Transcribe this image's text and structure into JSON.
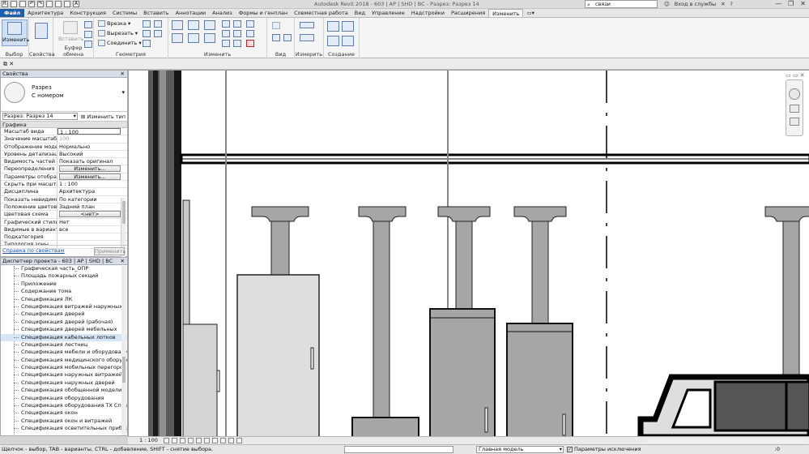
{
  "titlebar": {
    "qat_icons": [
      "revit-logo-icon",
      "open-icon",
      "save-icon",
      "undo-icon",
      "redo-icon",
      "print-icon",
      "measure-icon",
      "dimension-icon",
      "text-icon"
    ],
    "app_title": "Autodesk Revit 2018 -      603 | АР | SHD | ВС - Разрез: Разрез 14",
    "search_value": "связи",
    "signin": "Вход в службы",
    "window_buttons": [
      "—",
      "❐",
      "✕"
    ]
  },
  "tabs": [
    "Файл",
    "Архитектура",
    "Конструкция",
    "Системы",
    "Вставить",
    "Аннотации",
    "Анализ",
    "Формы и генплан",
    "Совместная работа",
    "Вид",
    "Управление",
    "Надстройки",
    "Расширения",
    "Изменить"
  ],
  "active_tab": "Изменить",
  "ribbon": {
    "panels": {
      "select": "Выбор",
      "properties": "Свойства",
      "clipboard": "Буфер обмена",
      "geometry": "Геометрия",
      "modify": "Изменить",
      "view": "Вид",
      "measure": "Измерить",
      "create": "Создание"
    },
    "modify_button": "Изменить",
    "paste_button": "Вставить",
    "geometry_items": [
      "Врезка",
      "Вырезать",
      "Соединить"
    ]
  },
  "properties_panel": {
    "title": "Свойства",
    "type_line1": "Разрез",
    "type_line2": "С номером",
    "filter_value": "Разрез: Разрез 14",
    "edit_type": "Изменить тип",
    "category": "Графика",
    "rows": [
      {
        "name": "Масштаб вида",
        "value": "1 : 100",
        "kind": "edit"
      },
      {
        "name": "Значение масштаба",
        "value": "100",
        "kind": "grey"
      },
      {
        "name": "Отображение модели",
        "value": "Нормально",
        "kind": "text"
      },
      {
        "name": "Уровень детализации",
        "value": "Высокий",
        "kind": "text"
      },
      {
        "name": "Видимость частей",
        "value": "Показать оригинал",
        "kind": "text"
      },
      {
        "name": "Переопределения ви...",
        "value": "Изменить...",
        "kind": "button"
      },
      {
        "name": "Параметры отображ...",
        "value": "Изменить...",
        "kind": "button"
      },
      {
        "name": "Скрыть при масштаб...",
        "value": "1 : 100",
        "kind": "text"
      },
      {
        "name": "Дисциплина",
        "value": "Архитектура",
        "kind": "text"
      },
      {
        "name": "Показать невидимые...",
        "value": "По категории",
        "kind": "text"
      },
      {
        "name": "Положение цветово...",
        "value": "Задний план",
        "kind": "text"
      },
      {
        "name": "Цветовая схема",
        "value": "<нет>",
        "kind": "button"
      },
      {
        "name": "Графический стиль ...",
        "value": "Нет",
        "kind": "text"
      },
      {
        "name": "Видимые в варианте",
        "value": "все",
        "kind": "text"
      },
      {
        "name": "Подкатегория",
        "value": "",
        "kind": "text"
      },
      {
        "name": "Типология зоны...",
        "value": "",
        "kind": "text"
      }
    ],
    "help_link": "Справка по свойствам",
    "apply": "Применить"
  },
  "project_browser": {
    "title": "Диспетчер проекта - 603 | АР | SHD | ВС",
    "items": [
      "Графическая часть_ОПР",
      "Площадь пожарных секций",
      "Приложение",
      "Содержание тома",
      "Спецификация ЛК",
      "Спецификация витражей наружных",
      "Спецификация дверей",
      "Спецификация дверей (рабочая)",
      "Спецификация дверей мебельных",
      "Спецификация кабельных лотков",
      "Спецификация лестниц",
      "Спецификация мебели и оборудования",
      "Спецификация медицинского оборудования",
      "Спецификация мобильных перегородок",
      "Спецификация наружных витражей",
      "Спецификация наружных дверей",
      "Спецификация обобщенной модели",
      "Спецификация оборудования",
      "Спецификация оборудования ТХ Спорт",
      "Спецификация окон",
      "Спецификация окон и витражей",
      "Спецификация осветительных приборов"
    ],
    "selected_index": 9
  },
  "view_control": {
    "scale": "1 : 100"
  },
  "statusbar": {
    "message": "Щелчок - выбор, TAB - варианты, CTRL - добавление, SHIFT - снятие выбора.",
    "workset": "Главная модель",
    "exclusions": "Параметры исключения",
    "count": ":0"
  },
  "colors": {
    "file_tab": "#1e5fa8",
    "selected_row": "#d5e6f7",
    "wall_dark": "#2b2b2b",
    "element_grey": "#a6a6a6"
  }
}
